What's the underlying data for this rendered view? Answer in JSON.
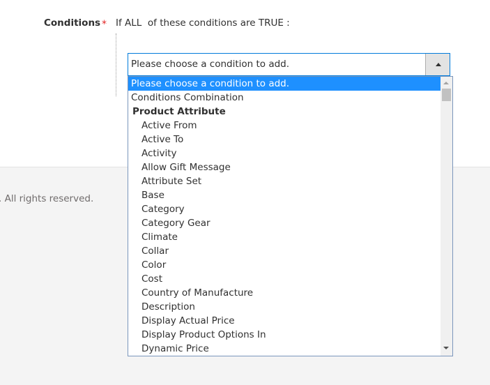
{
  "footer": {
    "copyright_text": ". All rights reserved."
  },
  "conditions": {
    "label": "Conditions",
    "required_marker": "*",
    "sentence": "If ALL  of these conditions are TRUE :"
  },
  "condition_select": {
    "value": "Please choose a condition to add.",
    "expanded": true,
    "options": [
      {
        "label": "Please choose a condition to add.",
        "type": "option",
        "selected": true
      },
      {
        "label": "Conditions Combination",
        "type": "option"
      },
      {
        "label": "Product Attribute",
        "type": "group"
      },
      {
        "label": "Active From",
        "type": "sub"
      },
      {
        "label": "Active To",
        "type": "sub"
      },
      {
        "label": "Activity",
        "type": "sub"
      },
      {
        "label": "Allow Gift Message",
        "type": "sub"
      },
      {
        "label": "Attribute Set",
        "type": "sub"
      },
      {
        "label": "Base",
        "type": "sub"
      },
      {
        "label": "Category",
        "type": "sub"
      },
      {
        "label": "Category Gear",
        "type": "sub"
      },
      {
        "label": "Climate",
        "type": "sub"
      },
      {
        "label": "Collar",
        "type": "sub"
      },
      {
        "label": "Color",
        "type": "sub"
      },
      {
        "label": "Cost",
        "type": "sub"
      },
      {
        "label": "Country of Manufacture",
        "type": "sub"
      },
      {
        "label": "Description",
        "type": "sub"
      },
      {
        "label": "Display Actual Price",
        "type": "sub"
      },
      {
        "label": "Display Product Options In",
        "type": "sub"
      },
      {
        "label": "Dynamic Price",
        "type": "sub"
      }
    ]
  },
  "icons": {
    "select_arrow": "triangle-up-icon",
    "scroll_up": "scroll-up-arrow-icon",
    "scroll_down": "scroll-down-arrow-icon"
  },
  "colors": {
    "selected_option_bg": "#1e90ff",
    "focus_border": "#007bdb",
    "required_star": "#e22626"
  }
}
